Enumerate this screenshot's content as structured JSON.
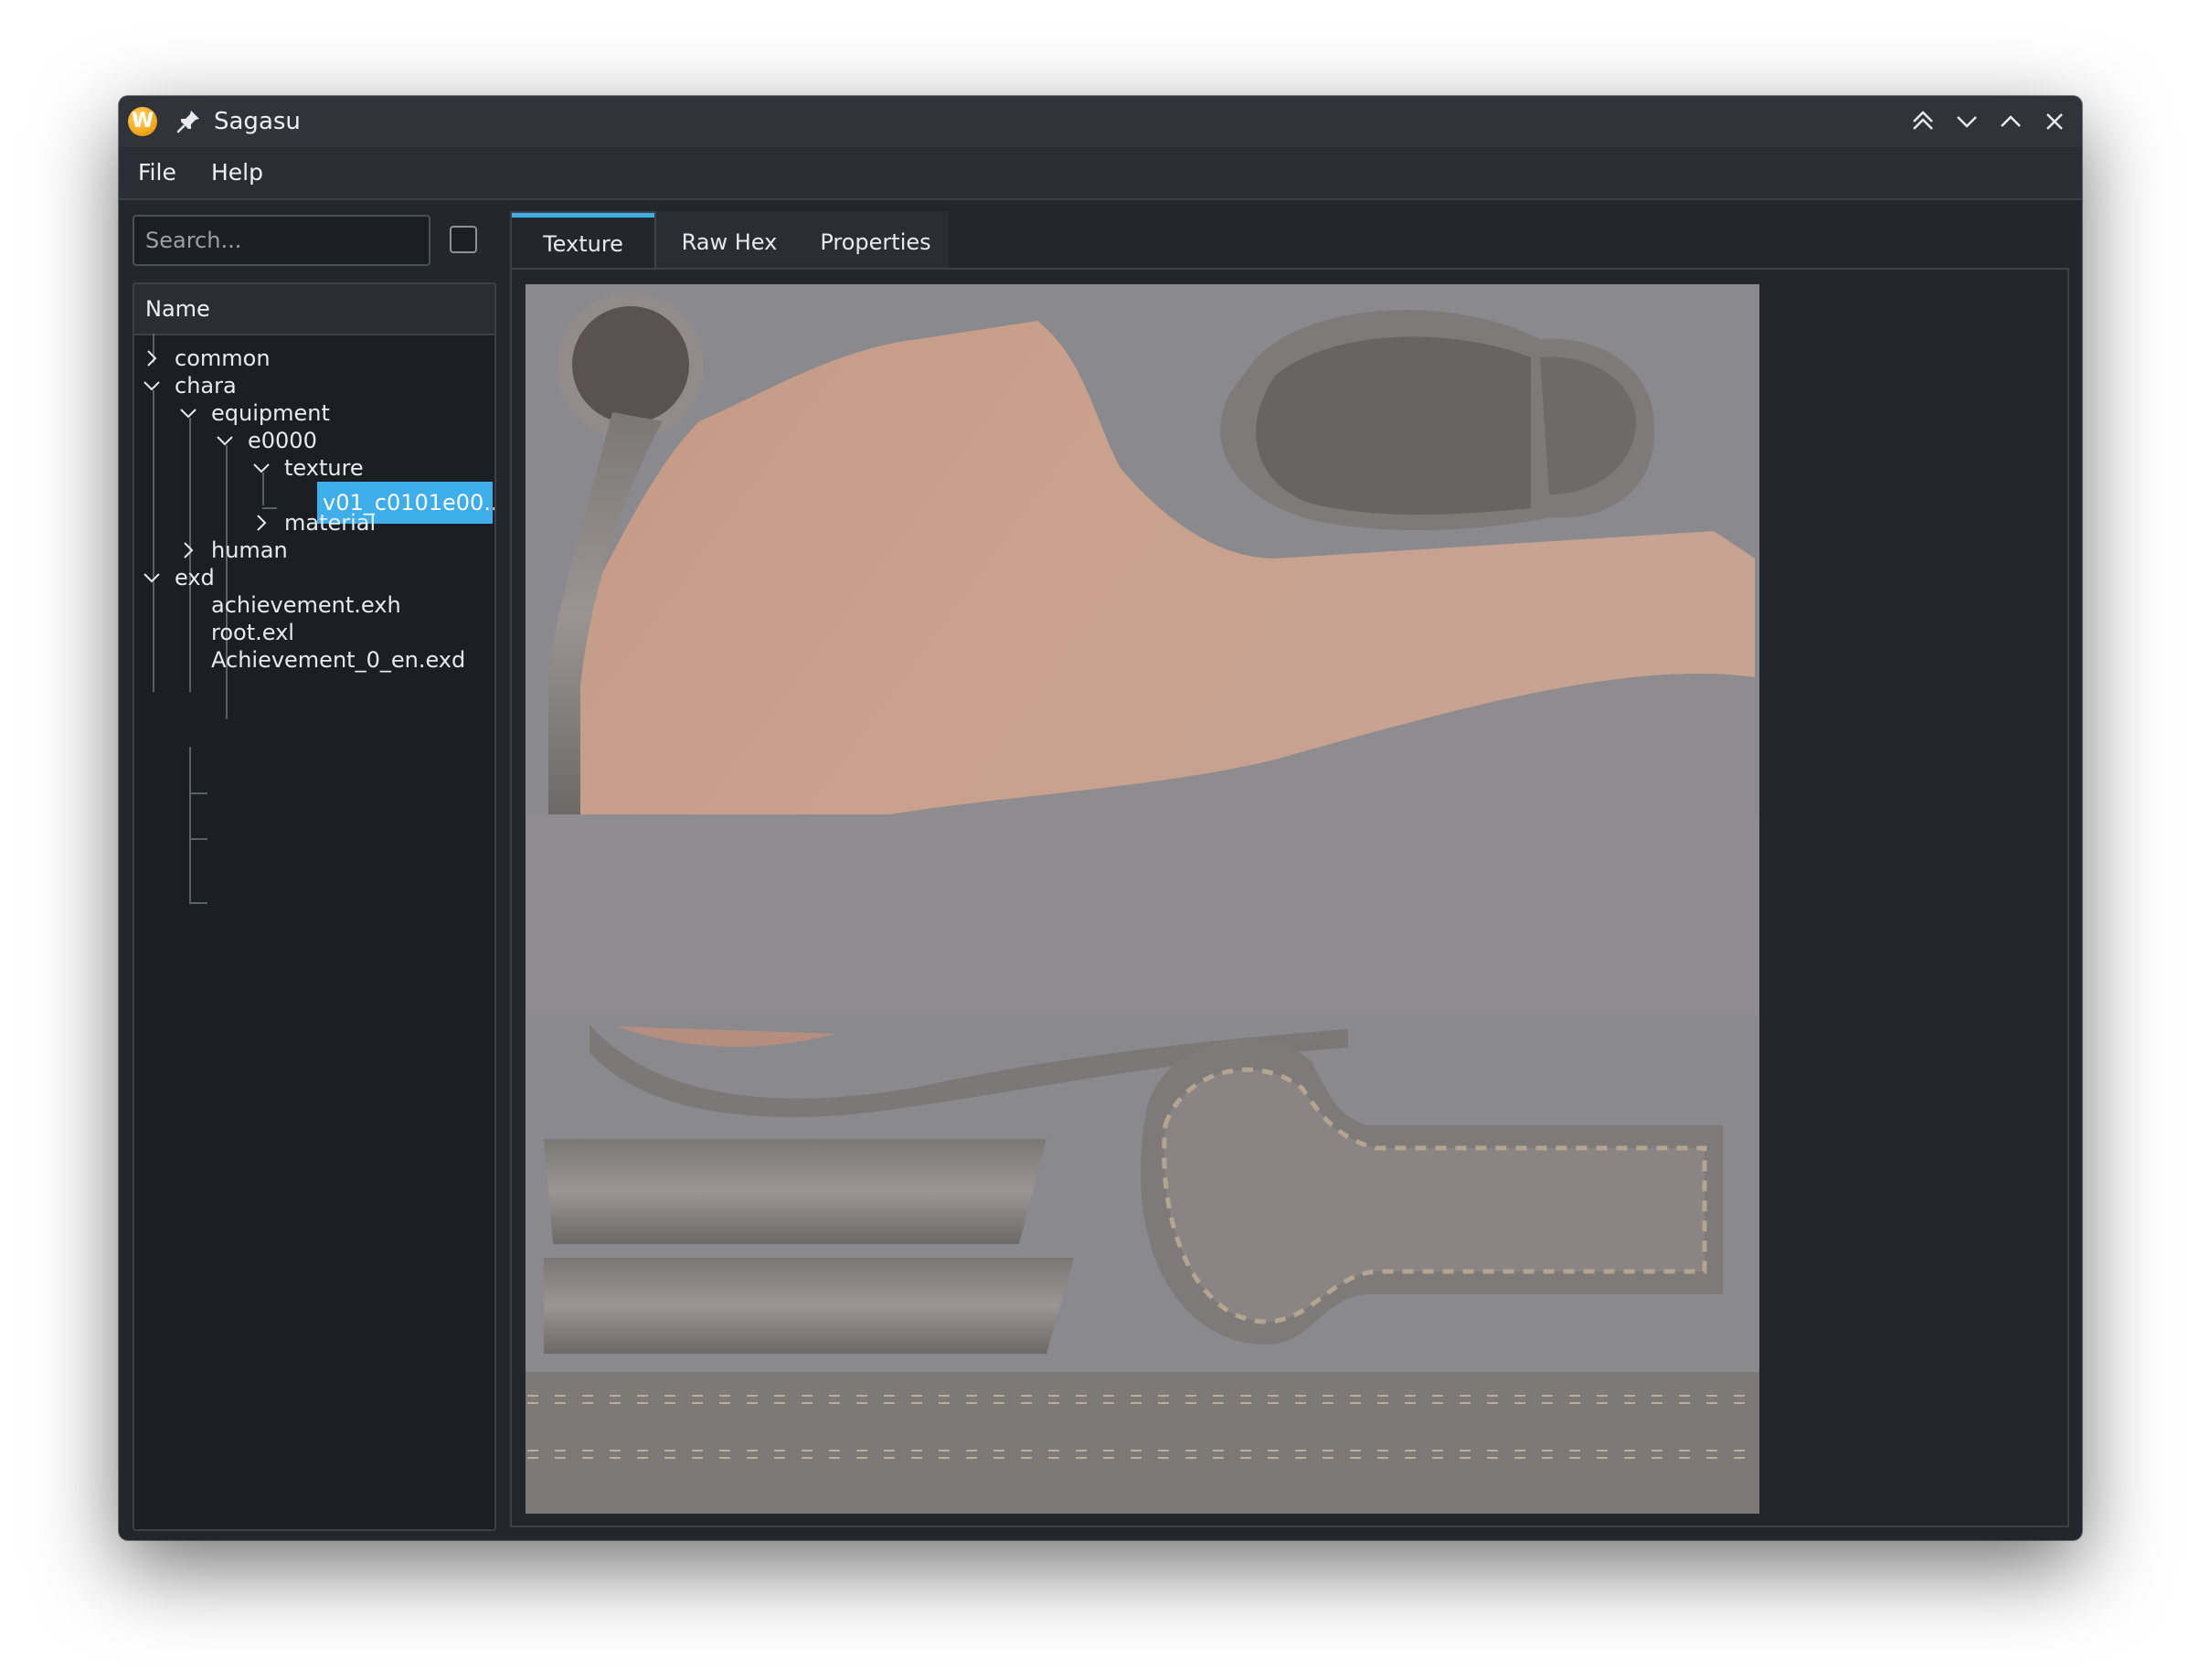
{
  "window": {
    "title": "Sagasu",
    "app_icon_letter": "W"
  },
  "menu": [
    "File",
    "Help"
  ],
  "search": {
    "placeholder": "Search...",
    "value": ""
  },
  "tree": {
    "header": "Name",
    "nodes": [
      {
        "label": "common",
        "depth": 0,
        "expanded": false
      },
      {
        "label": "chara",
        "depth": 0,
        "expanded": true
      },
      {
        "label": "equipment",
        "depth": 1,
        "expanded": true
      },
      {
        "label": "e0000",
        "depth": 2,
        "expanded": true
      },
      {
        "label": "texture",
        "depth": 3,
        "expanded": true
      },
      {
        "label": "v01_c0101e00...",
        "depth": 4,
        "selected": true
      },
      {
        "label": "material",
        "depth": 3,
        "expanded": false
      },
      {
        "label": "human",
        "depth": 1,
        "expanded": false
      },
      {
        "label": "exd",
        "depth": 0,
        "expanded": true
      },
      {
        "label": "achievement.exh",
        "depth": 1
      },
      {
        "label": "root.exl",
        "depth": 1
      },
      {
        "label": "Achievement_0_en.exd",
        "depth": 1
      }
    ]
  },
  "tabs": [
    {
      "label": "Texture",
      "active": true
    },
    {
      "label": "Raw Hex",
      "active": false
    },
    {
      "label": "Properties",
      "active": false
    }
  ],
  "colors": {
    "accent": "#3daee9",
    "background": "#23262b",
    "panel": "#1b1e22"
  }
}
